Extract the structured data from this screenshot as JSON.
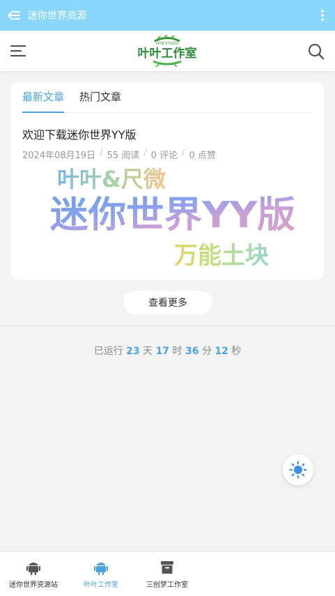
{
  "appbar": {
    "title": "迷你世界资源"
  },
  "header": {
    "logo_text": "叶叶工作室",
    "logo_subtext": "YEYE STUDIO"
  },
  "tabs": [
    {
      "label": "最新文章",
      "active": true
    },
    {
      "label": "热门文章",
      "active": false
    }
  ],
  "article": {
    "title": "欢迎下载迷你世界YY版",
    "date": "2024年08月19日",
    "reads": "55 阅读",
    "comments": "0 评论",
    "likes": "0 点赞",
    "banner": {
      "line1": "叶叶&尺微",
      "line2": "迷你世界YY版",
      "line3": "万能土块"
    }
  },
  "more_button": "查看更多",
  "uptime": {
    "prefix": "已运行",
    "days": "23",
    "days_unit": "天",
    "hours": "17",
    "hours_unit": "时",
    "minutes": "36",
    "minutes_unit": "分",
    "seconds": "12",
    "seconds_unit": "秒"
  },
  "bottom_nav": [
    {
      "label": "迷你世界资源站",
      "icon": "android-icon"
    },
    {
      "label": "叶叶工作室",
      "icon": "android-icon",
      "active": true
    },
    {
      "label": "三创梦工作室",
      "icon": "archive-icon"
    }
  ],
  "colors": {
    "appbar": "#89d7fb",
    "accent": "#4aa3df",
    "background": "#f3f3f4"
  }
}
